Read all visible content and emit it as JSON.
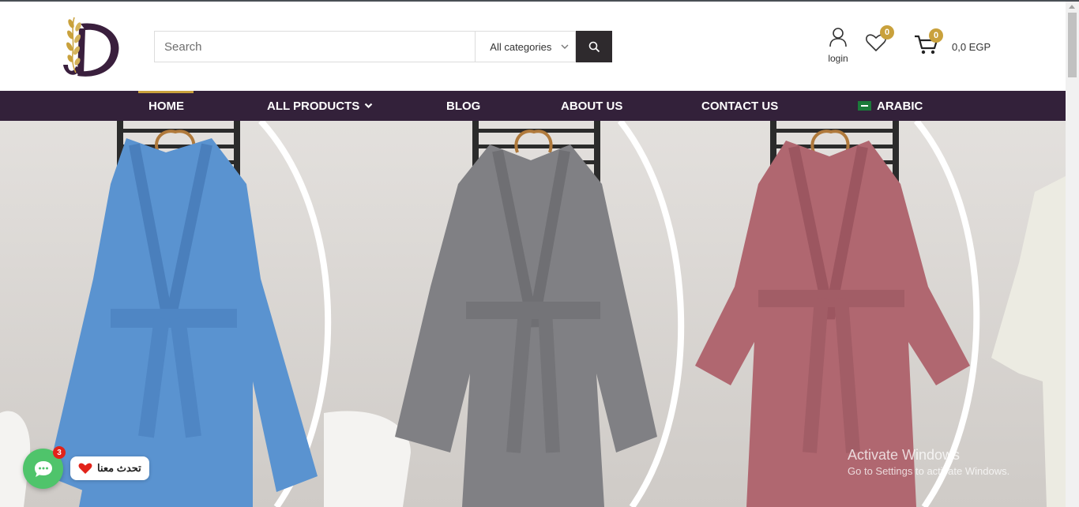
{
  "header": {
    "search_placeholder": "Search",
    "category_selected": "All categories",
    "login_label": "login",
    "wishlist_count": "0",
    "cart_count": "0",
    "cart_total": "0,0 EGP"
  },
  "nav": {
    "items": [
      {
        "label": "HOME",
        "active": true
      },
      {
        "label": "ALL PRODUCTS",
        "has_dropdown": true
      },
      {
        "label": "BLOG"
      },
      {
        "label": "ABOUT US"
      },
      {
        "label": "CONTACT US"
      },
      {
        "label": "ARABIC",
        "icon": "saudi-flag-icon"
      }
    ]
  },
  "hero": {
    "robes": [
      {
        "color": "#5a93d0",
        "name": "blue"
      },
      {
        "color": "#808084",
        "name": "grey"
      },
      {
        "color": "#b06770",
        "name": "rose"
      },
      {
        "color": "#ecebe2",
        "name": "white"
      }
    ]
  },
  "chat": {
    "badge_count": "3",
    "label": "تحدث معنا"
  },
  "watermark": {
    "title": "Activate Windows",
    "subtitle": "Go to Settings to activate Windows."
  },
  "colors": {
    "nav_bg": "#33213a",
    "accent_gold": "#c9a13c",
    "search_button": "#2e2a2d",
    "chat_green": "#4fc46b"
  }
}
